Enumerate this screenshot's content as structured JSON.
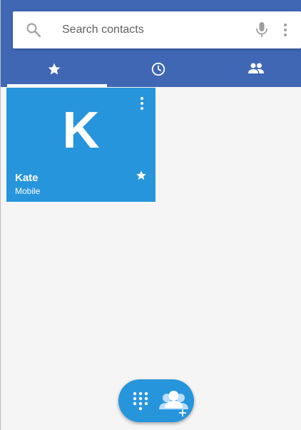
{
  "search": {
    "placeholder": "Search contacts"
  },
  "icons": {
    "search": "search-icon",
    "mic": "microphone-icon",
    "menu": "more-vert-icon",
    "favorites_tab": "star-icon",
    "recents_tab": "clock-icon",
    "contacts_tab": "people-icon",
    "dialpad": "dialpad-icon",
    "add_contacts": "group-add-icon"
  },
  "tabs": [
    {
      "name": "favorites",
      "selected": true
    },
    {
      "name": "recents",
      "selected": false
    },
    {
      "name": "contacts",
      "selected": false
    }
  ],
  "favorites": [
    {
      "initial": "K",
      "name": "Kate",
      "phone_type": "Mobile",
      "starred": true
    }
  ],
  "colors": {
    "header": "#3f67b4",
    "tile": "#2795dc",
    "fab": "#2795dc",
    "background": "#f5f5f5"
  }
}
